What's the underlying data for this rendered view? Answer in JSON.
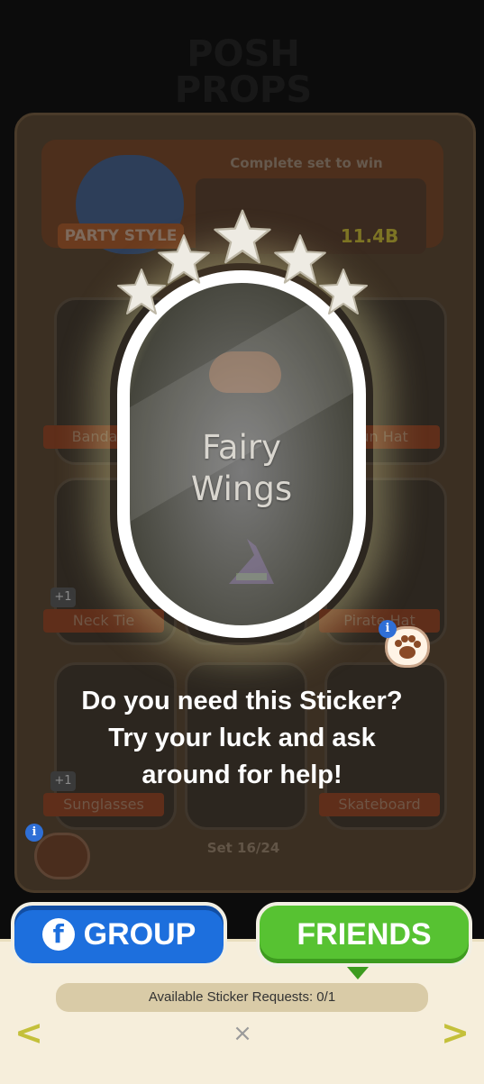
{
  "background": {
    "title_text": "POSH PROPS",
    "complete_set_text": "Complete set to win",
    "prize_value": "11.4B",
    "party_badge_label": "PARTY STYLE",
    "set_progress": "Set 16/24",
    "cards": [
      {
        "label": "Bandana",
        "plus": ""
      },
      {
        "label": "",
        "plus": ""
      },
      {
        "label": "Sun Hat",
        "plus": ""
      },
      {
        "label": "Neck Tie",
        "plus": "+1"
      },
      {
        "label": "",
        "plus": ""
      },
      {
        "label": "Pirate Hat",
        "plus": ""
      },
      {
        "label": "Sunglasses",
        "plus": "+1"
      },
      {
        "label": "",
        "plus": ""
      },
      {
        "label": "Skateboard",
        "plus": ""
      }
    ]
  },
  "sticker": {
    "name_line1": "Fairy",
    "name_line2": "Wings",
    "stars": 5
  },
  "prompt": {
    "line1": "Do you need this Sticker?",
    "line2": "Try your luck and ask",
    "line3": "around for help!"
  },
  "info_icon": "i",
  "buttons": {
    "group_label": "GROUP",
    "group_icon": "f",
    "friends_label": "FRIENDS"
  },
  "requests_text": "Available Sticker Requests: 0/1",
  "nav": {
    "prev": "<",
    "next": ">",
    "close": "×"
  },
  "colors": {
    "group_blue": "#1d6fdd",
    "friends_green": "#57c232",
    "panel_bg": "#f6eedb"
  }
}
